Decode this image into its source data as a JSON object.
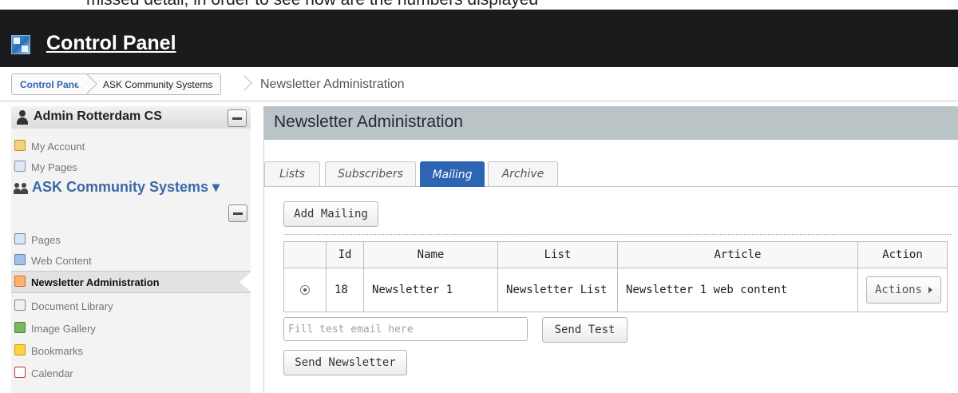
{
  "top_strip_text": "missed detail, in order to see how are the numbers displayed",
  "header": {
    "title": "Control Panel"
  },
  "breadcrumb": {
    "items": [
      "Control Panel",
      "ASK Community Systems"
    ],
    "current": "Newsletter Administration"
  },
  "sidebar": {
    "user_title": "Admin Rotterdam CS",
    "user_items": [
      {
        "label": "My Account",
        "icon": "user-settings-icon"
      },
      {
        "label": "My Pages",
        "icon": "my-pages-icon"
      }
    ],
    "community_title": "ASK Community Systems ▾",
    "items": [
      {
        "label": "Pages",
        "icon": "pages-icon"
      },
      {
        "label": "Web Content",
        "icon": "web-content-icon"
      },
      {
        "label": "Newsletter Administration",
        "icon": "newsletter-icon",
        "active": true
      },
      {
        "label": "Document Library",
        "icon": "document-library-icon"
      },
      {
        "label": "Image Gallery",
        "icon": "image-gallery-icon"
      },
      {
        "label": "Bookmarks",
        "icon": "bookmarks-icon"
      },
      {
        "label": "Calendar",
        "icon": "calendar-icon"
      }
    ]
  },
  "main": {
    "title": "Newsletter Administration",
    "tabs": [
      {
        "label": "Lists",
        "active": false
      },
      {
        "label": "Subscribers",
        "active": false
      },
      {
        "label": "Mailing",
        "active": true
      },
      {
        "label": "Archive",
        "active": false
      }
    ],
    "add_mailing_label": "Add Mailing",
    "table": {
      "columns": [
        "",
        "Id",
        "Name",
        "List",
        "Article",
        "Action"
      ],
      "rows": [
        {
          "selected": true,
          "id": "18",
          "name": "Newsletter 1",
          "list": "Newsletter List",
          "article": "Newsletter 1 web content",
          "action": "Actions"
        }
      ]
    },
    "email_placeholder": "Fill test email here",
    "send_test_label": "Send Test",
    "send_newsletter_label": "Send Newsletter"
  },
  "colors": {
    "header_bg": "#191b1d",
    "tab_active": "#2d65b3",
    "main_head_bg": "#bac3c6",
    "community_text": "#3a69a7"
  }
}
